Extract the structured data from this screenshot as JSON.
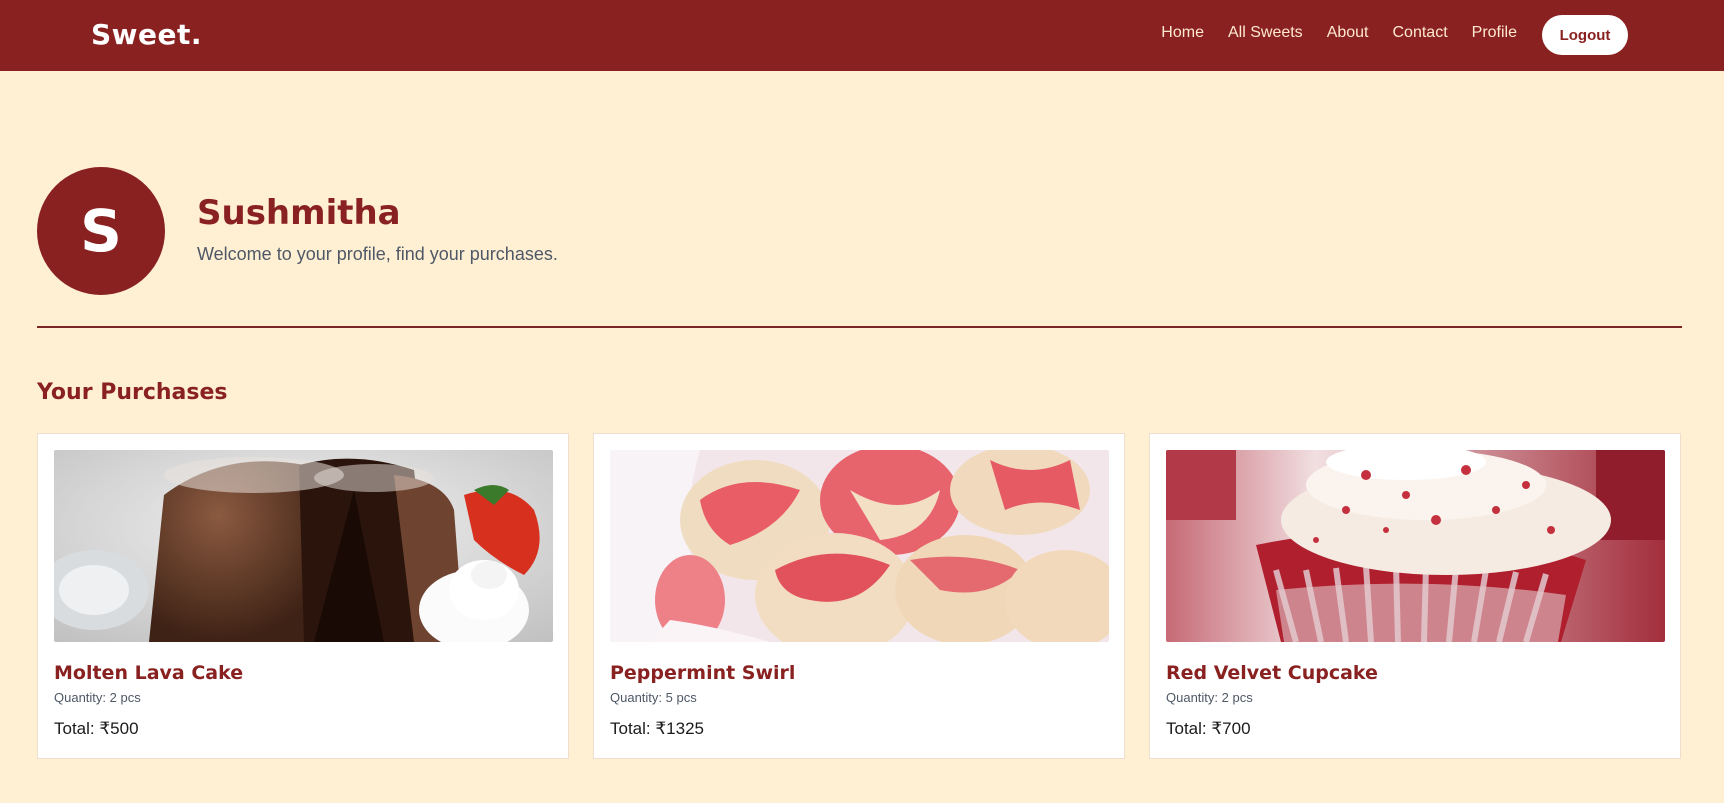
{
  "brand": "Sweet.",
  "nav": {
    "links": [
      "Home",
      "All Sweets",
      "About",
      "Contact",
      "Profile"
    ],
    "logout_label": "Logout"
  },
  "profile": {
    "initial": "S",
    "name": "Sushmitha",
    "subtitle": "Welcome to your profile, find your purchases."
  },
  "purchases": {
    "title": "Your Purchases",
    "items": [
      {
        "name": "Molten Lava Cake",
        "quantity": "Quantity: 2 pcs",
        "total": "Total: ₹500",
        "image_icon": "molten-lava-cake-image"
      },
      {
        "name": "Peppermint Swirl",
        "quantity": "Quantity: 5 pcs",
        "total": "Total: ₹1325",
        "image_icon": "peppermint-swirl-image"
      },
      {
        "name": "Red Velvet Cupcake",
        "quantity": "Quantity: 2 pcs",
        "total": "Total: ₹700",
        "image_icon": "red-velvet-cupcake-image"
      }
    ]
  },
  "colors": {
    "primary": "#8a2121",
    "background": "#fff0d4",
    "card": "#ffffff",
    "muted_text": "#4f5866"
  }
}
